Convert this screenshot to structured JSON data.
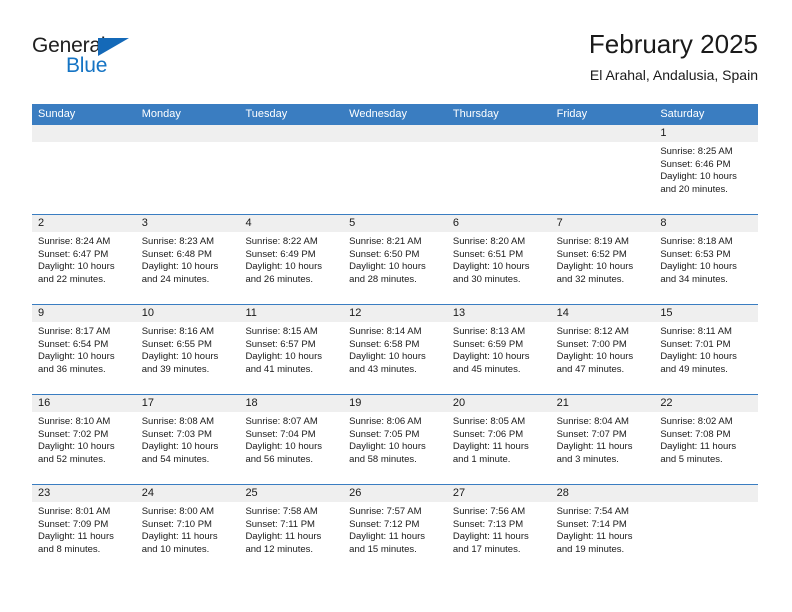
{
  "brand": {
    "name_part1": "General",
    "name_part2": "Blue",
    "triangle_color": "#1469b8",
    "blue_color": "#1574c4"
  },
  "header": {
    "month_title": "February 2025",
    "location": "El Arahal, Andalusia, Spain"
  },
  "theme": {
    "header_row_bg": "#3a7dc1",
    "day_head_bg": "#efefef",
    "row_divider": "#3a7dc1",
    "text": "#1a1a1a"
  },
  "weekdays": [
    "Sunday",
    "Monday",
    "Tuesday",
    "Wednesday",
    "Thursday",
    "Friday",
    "Saturday"
  ],
  "weeks": [
    [
      {
        "day": "",
        "sunrise": "",
        "sunset": "",
        "daylight_line1": "",
        "daylight_line2": "",
        "empty": true
      },
      {
        "day": "",
        "sunrise": "",
        "sunset": "",
        "daylight_line1": "",
        "daylight_line2": "",
        "empty": true
      },
      {
        "day": "",
        "sunrise": "",
        "sunset": "",
        "daylight_line1": "",
        "daylight_line2": "",
        "empty": true
      },
      {
        "day": "",
        "sunrise": "",
        "sunset": "",
        "daylight_line1": "",
        "daylight_line2": "",
        "empty": true
      },
      {
        "day": "",
        "sunrise": "",
        "sunset": "",
        "daylight_line1": "",
        "daylight_line2": "",
        "empty": true
      },
      {
        "day": "",
        "sunrise": "",
        "sunset": "",
        "daylight_line1": "",
        "daylight_line2": "",
        "empty": true
      },
      {
        "day": "1",
        "sunrise": "Sunrise: 8:25 AM",
        "sunset": "Sunset: 6:46 PM",
        "daylight_line1": "Daylight: 10 hours",
        "daylight_line2": "and 20 minutes."
      }
    ],
    [
      {
        "day": "2",
        "sunrise": "Sunrise: 8:24 AM",
        "sunset": "Sunset: 6:47 PM",
        "daylight_line1": "Daylight: 10 hours",
        "daylight_line2": "and 22 minutes."
      },
      {
        "day": "3",
        "sunrise": "Sunrise: 8:23 AM",
        "sunset": "Sunset: 6:48 PM",
        "daylight_line1": "Daylight: 10 hours",
        "daylight_line2": "and 24 minutes."
      },
      {
        "day": "4",
        "sunrise": "Sunrise: 8:22 AM",
        "sunset": "Sunset: 6:49 PM",
        "daylight_line1": "Daylight: 10 hours",
        "daylight_line2": "and 26 minutes."
      },
      {
        "day": "5",
        "sunrise": "Sunrise: 8:21 AM",
        "sunset": "Sunset: 6:50 PM",
        "daylight_line1": "Daylight: 10 hours",
        "daylight_line2": "and 28 minutes."
      },
      {
        "day": "6",
        "sunrise": "Sunrise: 8:20 AM",
        "sunset": "Sunset: 6:51 PM",
        "daylight_line1": "Daylight: 10 hours",
        "daylight_line2": "and 30 minutes."
      },
      {
        "day": "7",
        "sunrise": "Sunrise: 8:19 AM",
        "sunset": "Sunset: 6:52 PM",
        "daylight_line1": "Daylight: 10 hours",
        "daylight_line2": "and 32 minutes."
      },
      {
        "day": "8",
        "sunrise": "Sunrise: 8:18 AM",
        "sunset": "Sunset: 6:53 PM",
        "daylight_line1": "Daylight: 10 hours",
        "daylight_line2": "and 34 minutes."
      }
    ],
    [
      {
        "day": "9",
        "sunrise": "Sunrise: 8:17 AM",
        "sunset": "Sunset: 6:54 PM",
        "daylight_line1": "Daylight: 10 hours",
        "daylight_line2": "and 36 minutes."
      },
      {
        "day": "10",
        "sunrise": "Sunrise: 8:16 AM",
        "sunset": "Sunset: 6:55 PM",
        "daylight_line1": "Daylight: 10 hours",
        "daylight_line2": "and 39 minutes."
      },
      {
        "day": "11",
        "sunrise": "Sunrise: 8:15 AM",
        "sunset": "Sunset: 6:57 PM",
        "daylight_line1": "Daylight: 10 hours",
        "daylight_line2": "and 41 minutes."
      },
      {
        "day": "12",
        "sunrise": "Sunrise: 8:14 AM",
        "sunset": "Sunset: 6:58 PM",
        "daylight_line1": "Daylight: 10 hours",
        "daylight_line2": "and 43 minutes."
      },
      {
        "day": "13",
        "sunrise": "Sunrise: 8:13 AM",
        "sunset": "Sunset: 6:59 PM",
        "daylight_line1": "Daylight: 10 hours",
        "daylight_line2": "and 45 minutes."
      },
      {
        "day": "14",
        "sunrise": "Sunrise: 8:12 AM",
        "sunset": "Sunset: 7:00 PM",
        "daylight_line1": "Daylight: 10 hours",
        "daylight_line2": "and 47 minutes."
      },
      {
        "day": "15",
        "sunrise": "Sunrise: 8:11 AM",
        "sunset": "Sunset: 7:01 PM",
        "daylight_line1": "Daylight: 10 hours",
        "daylight_line2": "and 49 minutes."
      }
    ],
    [
      {
        "day": "16",
        "sunrise": "Sunrise: 8:10 AM",
        "sunset": "Sunset: 7:02 PM",
        "daylight_line1": "Daylight: 10 hours",
        "daylight_line2": "and 52 minutes."
      },
      {
        "day": "17",
        "sunrise": "Sunrise: 8:08 AM",
        "sunset": "Sunset: 7:03 PM",
        "daylight_line1": "Daylight: 10 hours",
        "daylight_line2": "and 54 minutes."
      },
      {
        "day": "18",
        "sunrise": "Sunrise: 8:07 AM",
        "sunset": "Sunset: 7:04 PM",
        "daylight_line1": "Daylight: 10 hours",
        "daylight_line2": "and 56 minutes."
      },
      {
        "day": "19",
        "sunrise": "Sunrise: 8:06 AM",
        "sunset": "Sunset: 7:05 PM",
        "daylight_line1": "Daylight: 10 hours",
        "daylight_line2": "and 58 minutes."
      },
      {
        "day": "20",
        "sunrise": "Sunrise: 8:05 AM",
        "sunset": "Sunset: 7:06 PM",
        "daylight_line1": "Daylight: 11 hours",
        "daylight_line2": "and 1 minute."
      },
      {
        "day": "21",
        "sunrise": "Sunrise: 8:04 AM",
        "sunset": "Sunset: 7:07 PM",
        "daylight_line1": "Daylight: 11 hours",
        "daylight_line2": "and 3 minutes."
      },
      {
        "day": "22",
        "sunrise": "Sunrise: 8:02 AM",
        "sunset": "Sunset: 7:08 PM",
        "daylight_line1": "Daylight: 11 hours",
        "daylight_line2": "and 5 minutes."
      }
    ],
    [
      {
        "day": "23",
        "sunrise": "Sunrise: 8:01 AM",
        "sunset": "Sunset: 7:09 PM",
        "daylight_line1": "Daylight: 11 hours",
        "daylight_line2": "and 8 minutes."
      },
      {
        "day": "24",
        "sunrise": "Sunrise: 8:00 AM",
        "sunset": "Sunset: 7:10 PM",
        "daylight_line1": "Daylight: 11 hours",
        "daylight_line2": "and 10 minutes."
      },
      {
        "day": "25",
        "sunrise": "Sunrise: 7:58 AM",
        "sunset": "Sunset: 7:11 PM",
        "daylight_line1": "Daylight: 11 hours",
        "daylight_line2": "and 12 minutes."
      },
      {
        "day": "26",
        "sunrise": "Sunrise: 7:57 AM",
        "sunset": "Sunset: 7:12 PM",
        "daylight_line1": "Daylight: 11 hours",
        "daylight_line2": "and 15 minutes."
      },
      {
        "day": "27",
        "sunrise": "Sunrise: 7:56 AM",
        "sunset": "Sunset: 7:13 PM",
        "daylight_line1": "Daylight: 11 hours",
        "daylight_line2": "and 17 minutes."
      },
      {
        "day": "28",
        "sunrise": "Sunrise: 7:54 AM",
        "sunset": "Sunset: 7:14 PM",
        "daylight_line1": "Daylight: 11 hours",
        "daylight_line2": "and 19 minutes."
      },
      {
        "day": "",
        "sunrise": "",
        "sunset": "",
        "daylight_line1": "",
        "daylight_line2": "",
        "empty": true
      }
    ]
  ]
}
